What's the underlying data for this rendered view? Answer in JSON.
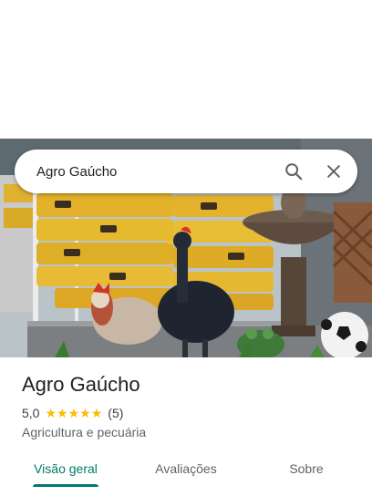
{
  "search": {
    "query": "Agro Gaúcho"
  },
  "icons": {
    "search": "search-icon",
    "close": "close-icon",
    "star": "star-icon"
  },
  "place": {
    "name": "Agro Gaúcho",
    "rating": "5,0",
    "stars": 5,
    "review_count": "(5)",
    "category": "Agricultura e pecuária"
  },
  "tabs": [
    {
      "label": "Visão geral",
      "active": true
    },
    {
      "label": "Avaliações",
      "active": false
    },
    {
      "label": "Sobre",
      "active": false
    }
  ],
  "colors": {
    "accent": "#00796b",
    "star": "#fbbc04",
    "text_primary": "#202124",
    "text_secondary": "#5f6368"
  }
}
